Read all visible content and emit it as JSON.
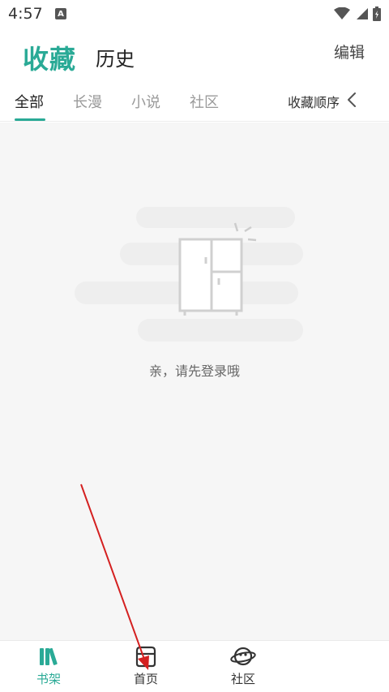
{
  "status_bar": {
    "time": "4:57",
    "notification_icon": "a-icon"
  },
  "header": {
    "title_favorites": "收藏",
    "title_history": "历史",
    "edit_label": "编辑"
  },
  "tabs": {
    "items": [
      {
        "label": "全部",
        "active": true
      },
      {
        "label": "长漫",
        "active": false
      },
      {
        "label": "小说",
        "active": false
      },
      {
        "label": "社区",
        "active": false
      }
    ],
    "sort_label": "收藏顺序"
  },
  "empty_state": {
    "message": "亲，请先登录哦",
    "icon": "cabinet-icon"
  },
  "bottom_nav": {
    "items": [
      {
        "label": "书架",
        "icon": "bookshelf-icon",
        "active": true
      },
      {
        "label": "首页",
        "icon": "home-icon",
        "active": false
      },
      {
        "label": "社区",
        "icon": "planet-icon",
        "active": false
      }
    ]
  },
  "colors": {
    "accent": "#2aaa96",
    "background": "#f6f6f6",
    "annotation_arrow": "#d42020"
  }
}
